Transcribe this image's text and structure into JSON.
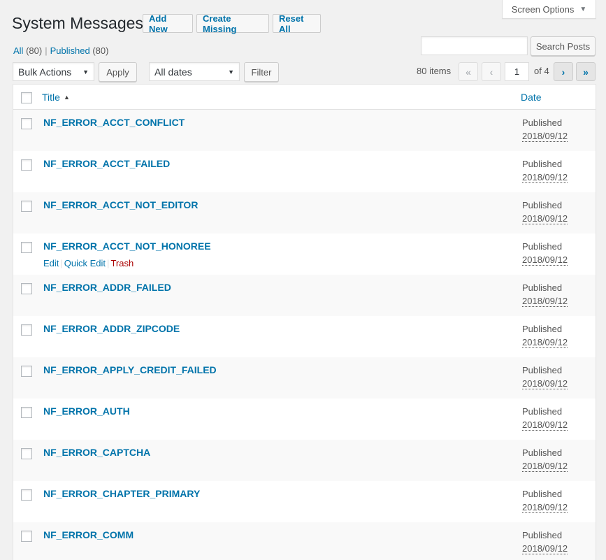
{
  "screen_options": {
    "label": "Screen Options",
    "icon": "caret-down-icon"
  },
  "header": {
    "title": "System Messages",
    "buttons": {
      "add_new": "Add New",
      "create_missing": "Create Missing",
      "reset_all": "Reset All"
    }
  },
  "filters": {
    "all_label": "All",
    "all_count": "(80)",
    "separator": "|",
    "published_label": "Published",
    "published_count": "(80)"
  },
  "search": {
    "value": "",
    "button": "Search Posts"
  },
  "toolbar": {
    "bulk_actions": "Bulk Actions",
    "apply": "Apply",
    "dates": "All dates",
    "filter": "Filter",
    "items_count": "80 items",
    "current_page": "1",
    "of_pages": "of 4",
    "first": "«",
    "prev": "‹",
    "next": "›",
    "last": "»"
  },
  "table": {
    "columns": {
      "title": "Title",
      "date": "Date"
    },
    "row_actions": {
      "edit": "Edit",
      "quick_edit": "Quick Edit",
      "trash": "Trash",
      "separator": "|"
    },
    "rows": [
      {
        "title": "NF_ERROR_ACCT_CONFLICT",
        "status": "Published",
        "date": "2018/09/12"
      },
      {
        "title": "NF_ERROR_ACCT_FAILED",
        "status": "Published",
        "date": "2018/09/12"
      },
      {
        "title": "NF_ERROR_ACCT_NOT_EDITOR",
        "status": "Published",
        "date": "2018/09/12"
      },
      {
        "title": "NF_ERROR_ACCT_NOT_HONOREE",
        "status": "Published",
        "date": "2018/09/12"
      },
      {
        "title": "NF_ERROR_ADDR_FAILED",
        "status": "Published",
        "date": "2018/09/12"
      },
      {
        "title": "NF_ERROR_ADDR_ZIPCODE",
        "status": "Published",
        "date": "2018/09/12"
      },
      {
        "title": "NF_ERROR_APPLY_CREDIT_FAILED",
        "status": "Published",
        "date": "2018/09/12"
      },
      {
        "title": "NF_ERROR_AUTH",
        "status": "Published",
        "date": "2018/09/12"
      },
      {
        "title": "NF_ERROR_CAPTCHA",
        "status": "Published",
        "date": "2018/09/12"
      },
      {
        "title": "NF_ERROR_CHAPTER_PRIMARY",
        "status": "Published",
        "date": "2018/09/12"
      },
      {
        "title": "NF_ERROR_COMM",
        "status": "Published",
        "date": "2018/09/12"
      }
    ]
  }
}
